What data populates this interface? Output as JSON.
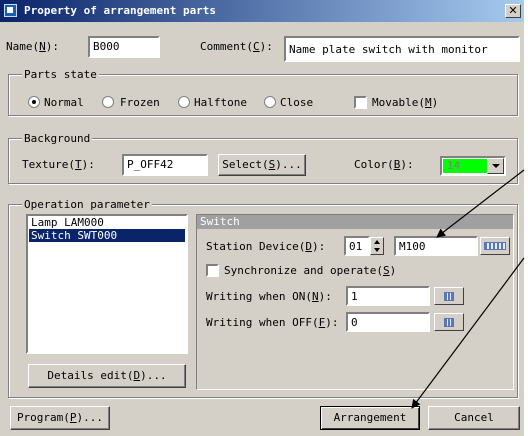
{
  "window": {
    "title": "Property of arrangement parts",
    "close_glyph": "✕"
  },
  "name": {
    "label": "Name",
    "hotkey": "N",
    "value": "B000"
  },
  "comment": {
    "label": "Comment",
    "hotkey": "C",
    "value": "Name plate switch with monitor"
  },
  "parts_state": {
    "title": "Parts state",
    "options": [
      {
        "label": "Normal",
        "selected": true
      },
      {
        "label": "Frozen",
        "selected": false
      },
      {
        "label": "Halftone",
        "selected": false
      },
      {
        "label": "Close",
        "selected": false
      }
    ],
    "movable": {
      "label": "Movable",
      "hotkey": "M",
      "checked": false
    }
  },
  "background": {
    "title": "Background",
    "texture_label": "Texture",
    "texture_hotkey": "T",
    "texture_value": "P_OFF42",
    "select_label": "Select",
    "select_hotkey": "S",
    "color_label": "Color",
    "color_hotkey": "B",
    "color_value": "14",
    "color_swatch": "#00ff00"
  },
  "operation": {
    "title": "Operation parameter",
    "list_items": [
      "Lamp LAM000",
      "Switch SWT000"
    ],
    "selected_index": 1,
    "details_label": "Details edit",
    "details_hotkey": "D",
    "panel_title": "Switch",
    "station_label": "Station Device",
    "station_hotkey": "D",
    "station_value": "01",
    "device_value": "M100",
    "sync_label": "Synchronize and operate",
    "sync_hotkey": "S",
    "sync_checked": false,
    "on_label": "Writing when ON",
    "on_hotkey": "N",
    "on_value": "1",
    "off_label": "Writing when OFF",
    "off_hotkey": "F",
    "off_value": "0"
  },
  "footer": {
    "program_label": "Program",
    "program_hotkey": "P",
    "arrangement_label": "Arrangement",
    "cancel_label": "Cancel"
  },
  "colors": {
    "title_bar": "#0a246a",
    "dialog_face": "#d4d0c8",
    "selection": "#0a246a",
    "annotation_arrow": "#000000"
  }
}
